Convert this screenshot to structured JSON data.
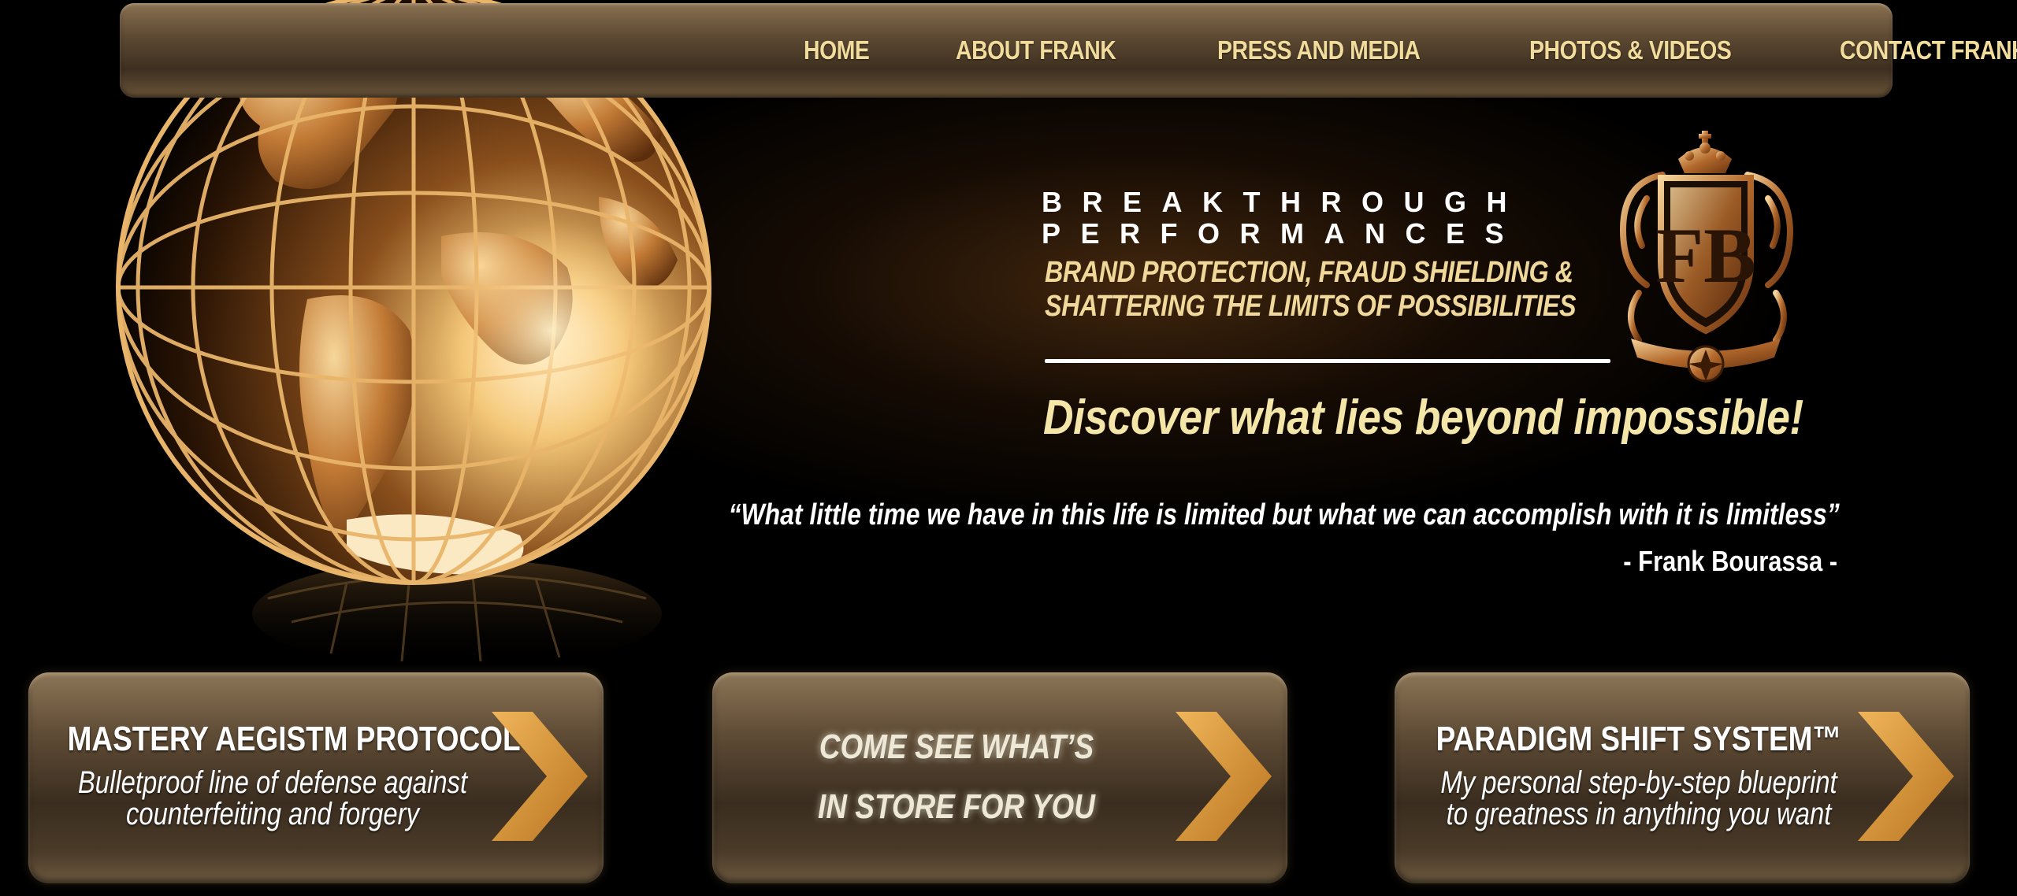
{
  "nav": {
    "items": [
      {
        "label": "HOME"
      },
      {
        "label": "ABOUT FRANK"
      },
      {
        "label": "PRESS AND MEDIA"
      },
      {
        "label": "PHOTOS & VIDEOS"
      },
      {
        "label": "CONTACT FRANK"
      }
    ]
  },
  "brand": {
    "line1": "BREAKTHROUGH",
    "line2": "PERFORMANCES",
    "tagline1": "BRAND PROTECTION, FRAUD SHIELDING &",
    "tagline2": "SHATTERING THE LIMITS OF POSSIBILITIES",
    "slogan": "Discover what lies beyond impossible!",
    "crest_monogram": "FB"
  },
  "quote": {
    "text": "“What little time we have in this life is limited but what we can accomplish with it is limitless”",
    "author": "- Frank Bourassa -"
  },
  "cta": [
    {
      "title": "MASTERY AEGIStm PROTOCOL",
      "sub1": "Bulletproof line of defense against",
      "sub2": "counterfeiting and forgery"
    },
    {
      "line1": "COME SEE WHAT’S",
      "line2": "IN STORE FOR YOU"
    },
    {
      "title": "PARADIGM SHIFT SYSTEM™",
      "sub1": "My personal step-by-step blueprint",
      "sub2": "to greatness in anything you want"
    }
  ],
  "colors": {
    "gold": "#f1dc9c",
    "arrow": "#d99a3a",
    "background": "#000000"
  }
}
